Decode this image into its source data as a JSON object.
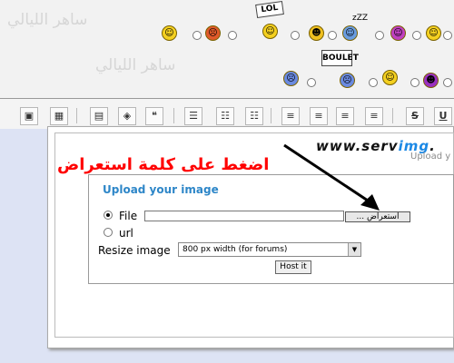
{
  "watermark": "ساهر الليالي",
  "smileys": [
    {
      "icon": "jester-smiley-icon",
      "color": "#f4d020",
      "glyph": "☺"
    },
    {
      "icon": "red-smiley-icon",
      "color": "#e05a2a",
      "glyph": "☹"
    },
    {
      "icon": "lol-sign-smiley-icon",
      "color": "#f4d020",
      "glyph": "☺",
      "sign": "LOL"
    },
    {
      "icon": "devil-smiley-icon",
      "color": "#f0c020",
      "glyph": "☻"
    },
    {
      "icon": "sleeping-smiley-icon",
      "color": "#6a9de0",
      "glyph": "☺",
      "zzz": "zZZ"
    },
    {
      "icon": "purple-smiley-icon",
      "color": "#c040c0",
      "glyph": "☺"
    },
    {
      "icon": "yellow-smiley-icon",
      "color": "#f4d020",
      "glyph": "☺"
    },
    {
      "icon": "blue-smiley-icon",
      "color": "#6a8ae0",
      "glyph": "☹"
    },
    {
      "icon": "boulet-sign-smiley-icon",
      "color": "#6a8ae0",
      "glyph": "☹",
      "sign": "BOULET"
    },
    {
      "icon": "blue-hat-smiley-icon",
      "color": "#3a6ad0",
      "glyph": "☺"
    },
    {
      "icon": "cheer-smiley-icon",
      "color": "#f4d020",
      "glyph": "☺"
    },
    {
      "icon": "purple-devil-smiley-icon",
      "color": "#9a30c0",
      "glyph": "☻"
    }
  ],
  "upload_dialog": {
    "logo_prefix": "www.serv",
    "logo_accent": "img",
    "logo_suffix": ".",
    "upload_tag": "Upload y",
    "title": "Upload your image",
    "option_file": "File",
    "option_url": "url",
    "file_value": "",
    "browse_label": "... استعراض",
    "resize_label": "Resize image",
    "resize_selected": "800 px width (for forums)",
    "host_button": "Host it"
  },
  "callout": "اضغط على كلمة استعراض",
  "colors": {
    "accent_blue": "#2d86c8",
    "callout_red": "#ff0000",
    "editor_background": "#dde3f4"
  }
}
